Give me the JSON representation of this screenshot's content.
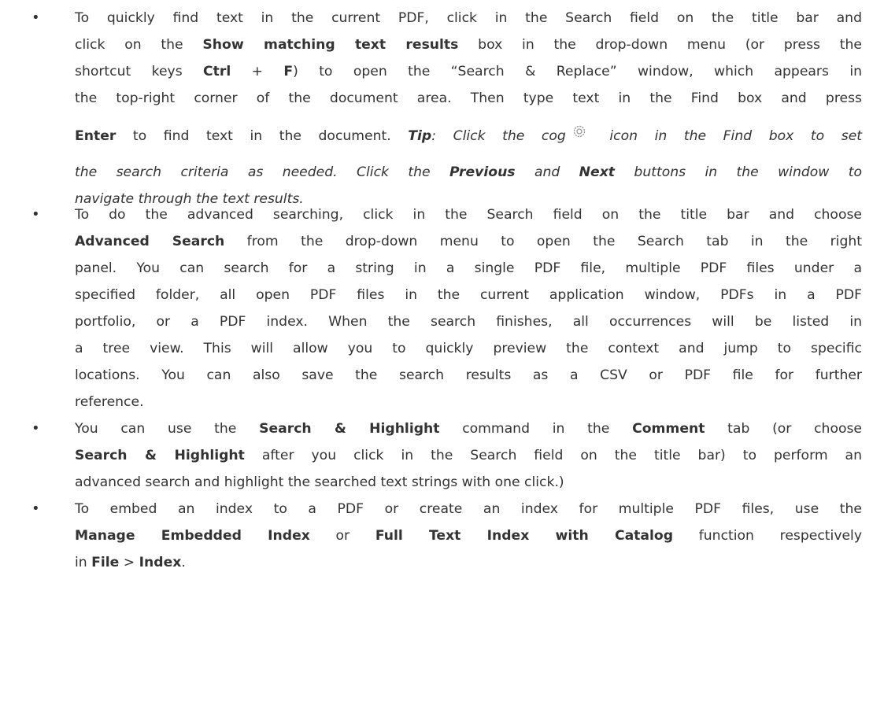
{
  "bullets": [
    {
      "lines": [
        [
          "To quickly find text in the current PDF, click in the Search field on the title bar and"
        ],
        [
          "click on the ",
          "Show matching text results",
          " box in the drop-down menu (or press the"
        ],
        [
          "shortcut keys ",
          "Ctrl",
          " + ",
          "F",
          ") to open the “Search & Replace” window, which appears in"
        ],
        [
          "the top-right corner of the document area. Then type text in the Find box and press"
        ],
        [
          "Enter",
          " to find text in the document. ",
          "Tip",
          ": Click the cog",
          " icon in the Find box to set"
        ],
        [
          "the search criteria as needed. Click the ",
          "Previous",
          " and ",
          "Next",
          " buttons in the window to"
        ],
        [
          "navigate through the text results."
        ]
      ]
    },
    {
      "lines": [
        [
          "To do the advanced searching, click in the Search field on the title bar and choose"
        ],
        [
          "Advanced Search",
          " from the drop-down menu to open the Search tab in the right"
        ],
        [
          "panel. You can search for a string in a single PDF file, multiple PDF files under a"
        ],
        [
          "specified folder, all open PDF files in the current application window, PDFs in a PDF"
        ],
        [
          "portfolio, or a PDF index. When the search finishes, all occurrences will be listed in"
        ],
        [
          "a tree view. This will allow you to quickly preview the context and jump to specific"
        ],
        [
          "locations. You can also save the search results as a CSV or PDF file for further"
        ],
        [
          "reference."
        ]
      ]
    },
    {
      "lines": [
        [
          "You can use the ",
          "Search & Highlight",
          " command in the ",
          "Comment",
          " tab (or choose"
        ],
        [
          "Search & Highlight",
          " after you click in the Search field on the title bar) to perform an"
        ],
        [
          "advanced search and highlight the searched text strings with one click.)"
        ]
      ]
    },
    {
      "lines": [
        [
          "To embed an index to a PDF or create an index for multiple PDF files, use the"
        ],
        [
          "Manage Embedded Index",
          " or ",
          "Full Text Index with Catalog",
          " function respectively"
        ],
        [
          "in ",
          "File",
          " > ",
          "Index",
          "."
        ]
      ]
    }
  ],
  "bullet_symbol": "•",
  "icons": {
    "cog": "cog-icon"
  }
}
